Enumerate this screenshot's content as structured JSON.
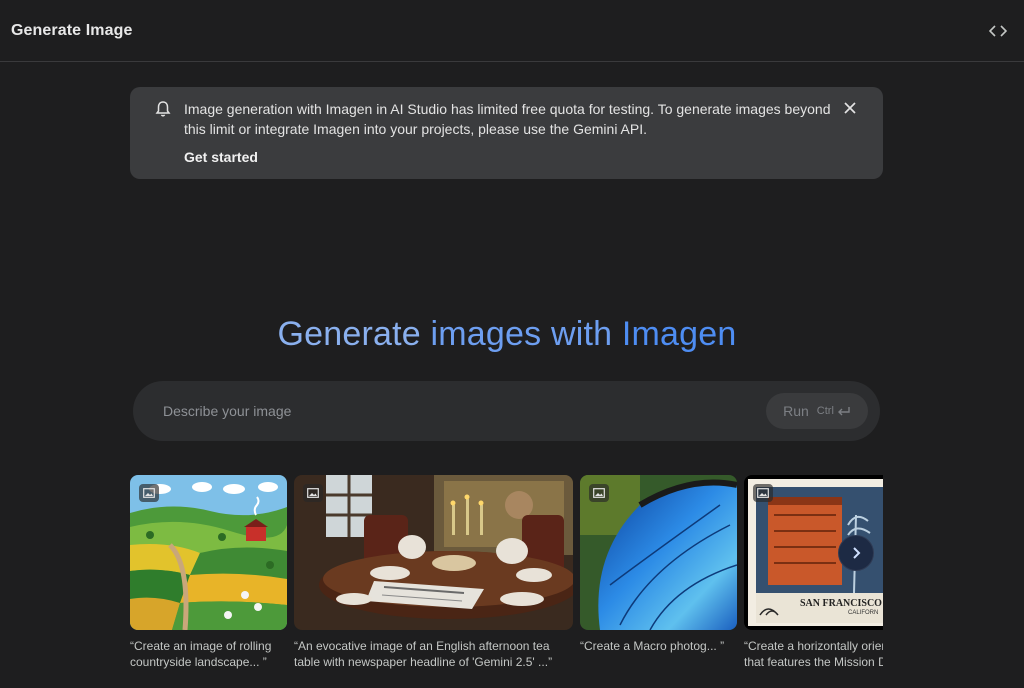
{
  "header": {
    "title": "Generate Image",
    "code_icon": "code-brackets-icon"
  },
  "banner": {
    "icon": "bell-icon",
    "message": "Image generation with Imagen in AI Studio has limited free quota for testing. To generate images beyond this limit or integrate Imagen into your projects, please use the Gemini API.",
    "cta": "Get started",
    "close_icon": "close-icon"
  },
  "hero": {
    "part1": "Generate ",
    "part2": "images with ",
    "part3": "Imagen"
  },
  "prompt": {
    "placeholder": "Describe your image",
    "run_label": "Run",
    "shortcut": "Ctrl"
  },
  "examples": [
    {
      "caption": "“Create an image of rolling\ncountryside landscape... ”"
    },
    {
      "caption": "“An evocative image of an English afternoon tea\ntable with newspaper headline of 'Gemini 2.5' ...”"
    },
    {
      "caption": "“Create a Macro photog... ”"
    },
    {
      "caption": "“Create a horizontally orien\nthat features the Mission D",
      "stamp_text": "SAN FRANCISCO",
      "stamp_sub": "CALIFORN"
    }
  ],
  "colors": {
    "background": "#1e1e1f",
    "banner": "#3b3c3e",
    "hero_blue": "#4e8df2"
  }
}
